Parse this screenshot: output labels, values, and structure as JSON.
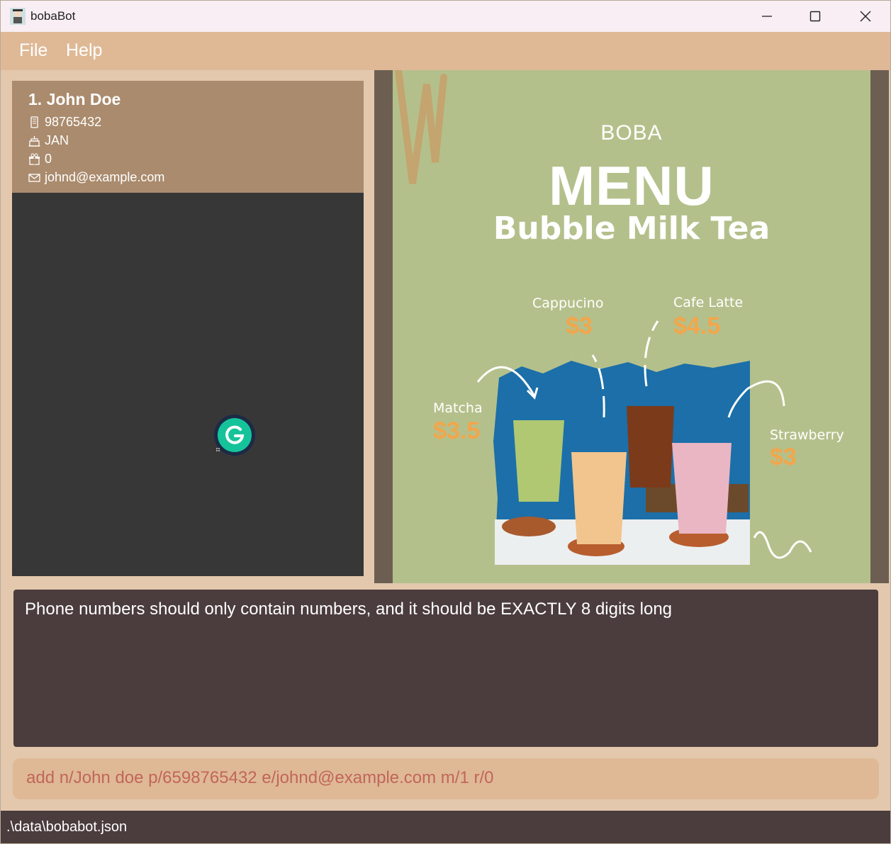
{
  "window": {
    "title": "bobaBot"
  },
  "menu": {
    "file": "File",
    "help": "Help"
  },
  "person": {
    "index_name": "1.  John Doe",
    "phone": "98765432",
    "birthday_month": "JAN",
    "rewards": "0",
    "email": "johnd@example.com"
  },
  "poster": {
    "boba": "BOBA",
    "menu": "MENU",
    "subtitle": "Bubble Milk Tea",
    "items": [
      {
        "name": "Cappucino",
        "price": "$3"
      },
      {
        "name": "Cafe Latte",
        "price": "$4.5"
      },
      {
        "name": "Matcha",
        "price": "$3.5"
      },
      {
        "name": "Strawberry",
        "price": "$3"
      }
    ]
  },
  "result": {
    "message": "Phone numbers should only contain numbers, and it should be EXACTLY 8 digits long"
  },
  "command": {
    "value": "add n/John doe p/6598765432 e/johnd@example.com m/1 r/0"
  },
  "status": {
    "path": ".\\data\\bobabot.json"
  },
  "colors": {
    "menubar": "#dfb996",
    "card": "#aa8b6d",
    "list_bg": "#373737",
    "result_bg": "#4b3c3d",
    "command_text": "#c1665a",
    "price": "#f3a64b",
    "poster_bg": "#b4c08b"
  },
  "icons": [
    "app-icon",
    "minimize-icon",
    "maximize-icon",
    "close-icon",
    "phone-icon",
    "birthday-cake-icon",
    "gift-icon",
    "email-icon",
    "grammarly-icon"
  ]
}
